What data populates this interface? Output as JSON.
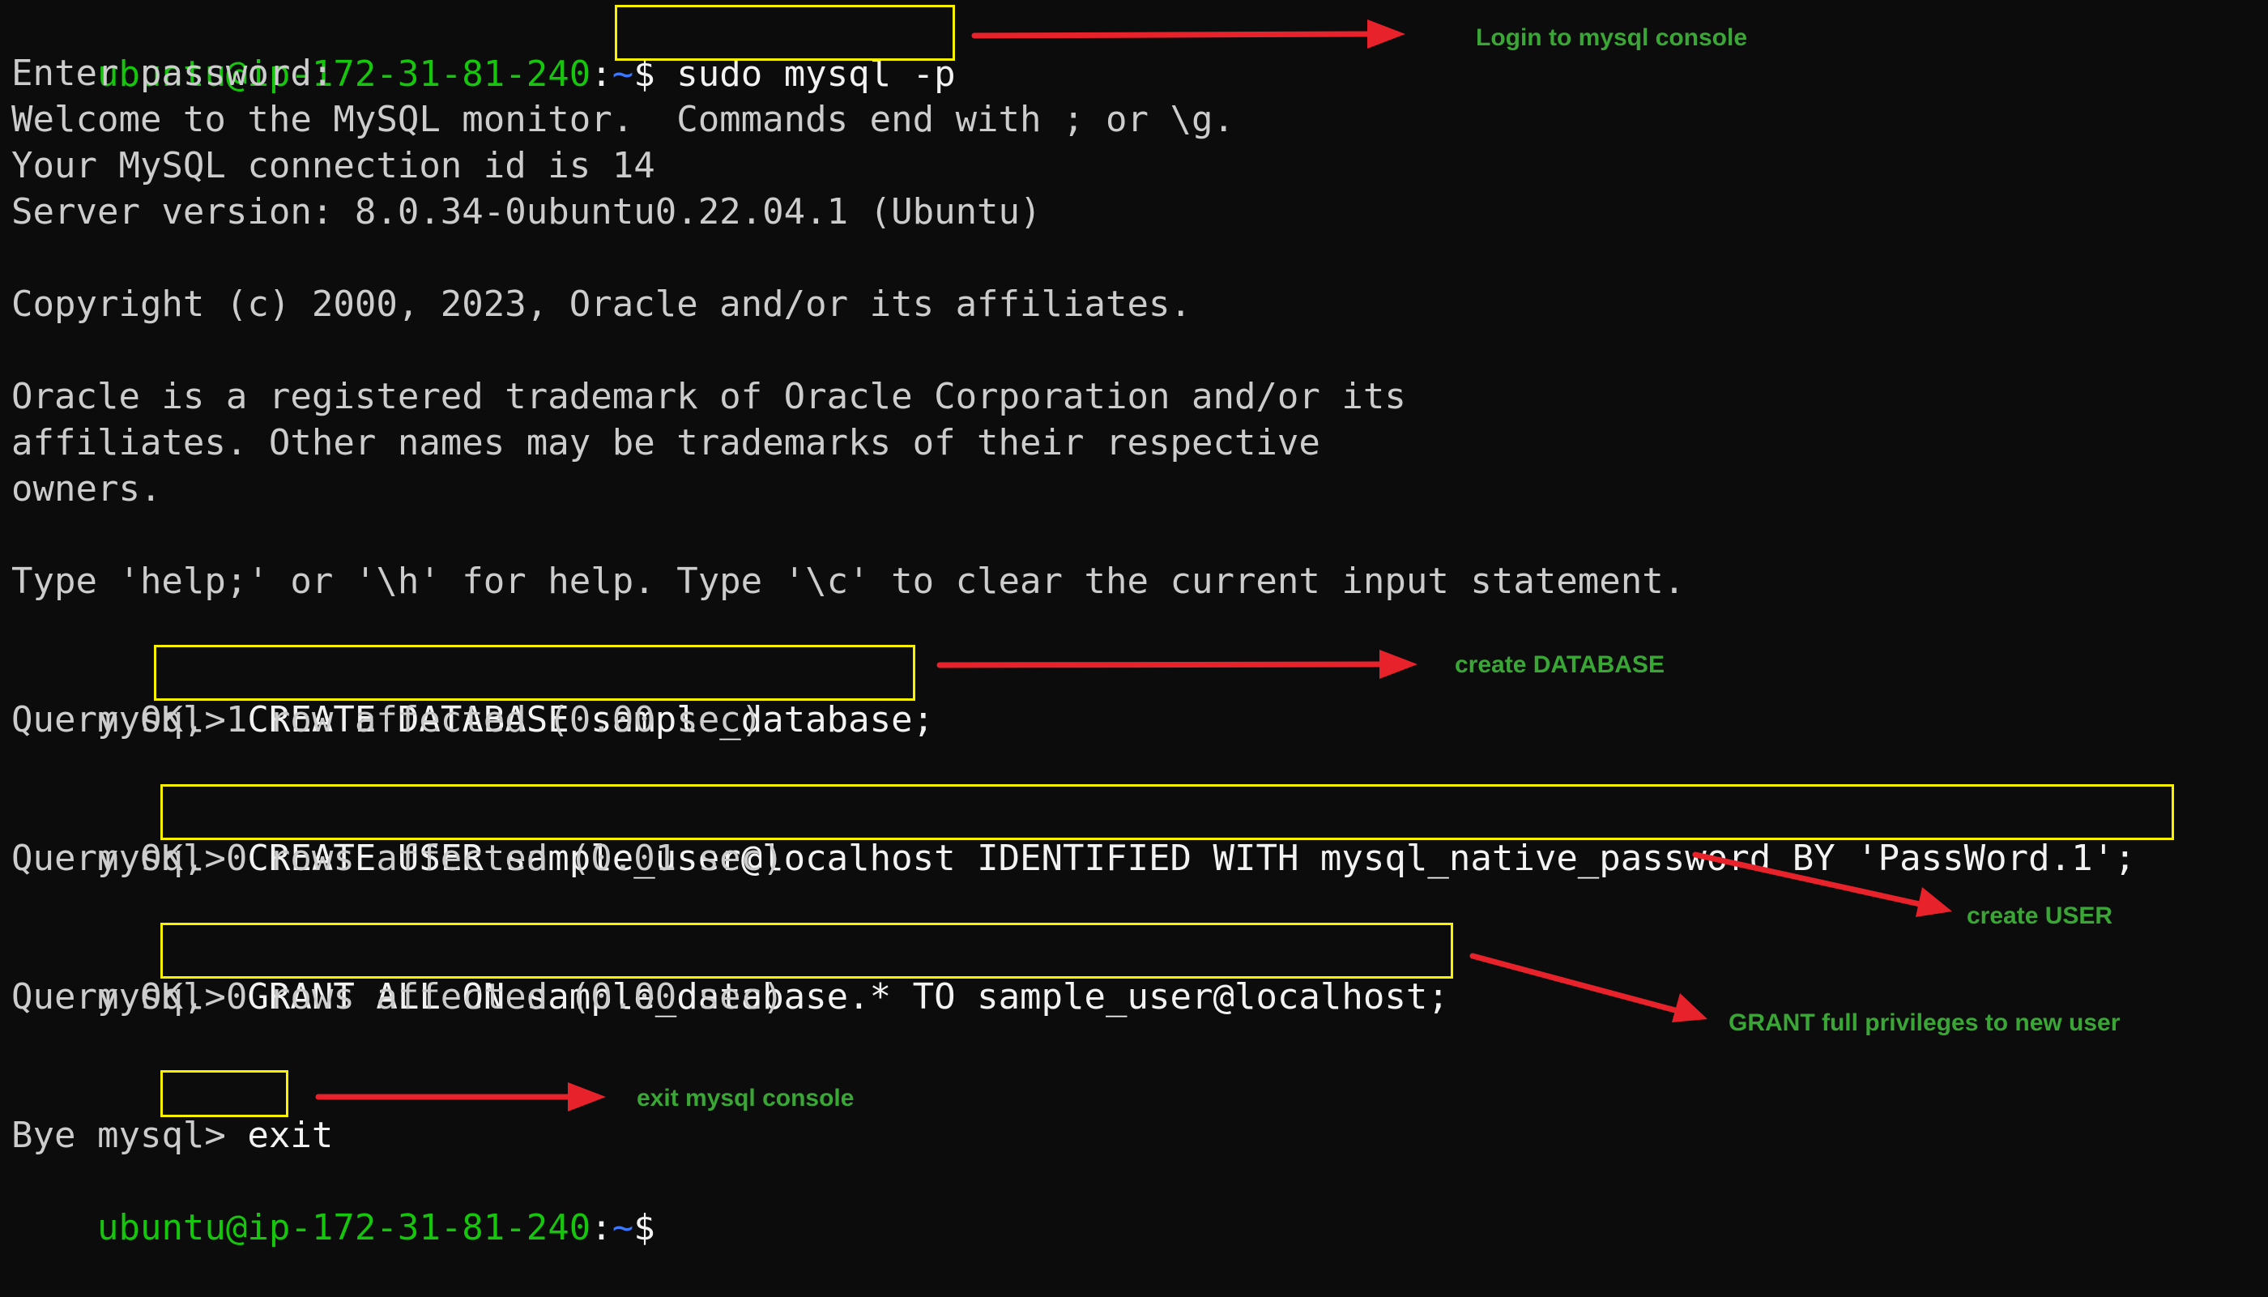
{
  "prompt": {
    "user_host": "ubuntu@ip-172-31-81-240",
    "sep": ":",
    "path": "~",
    "dollar": "$"
  },
  "lines": {
    "cmd_login": " sudo mysql -p",
    "enter_password": "Enter password:",
    "welcome": "Welcome to the MySQL monitor.  Commands end with ; or \\g.",
    "connection_id": "Your MySQL connection id is 14",
    "server_version": "Server version: 8.0.34-0ubuntu0.22.04.1 (Ubuntu)",
    "copyright": "Copyright (c) 2000, 2023, Oracle and/or its affiliates.",
    "trademark_1": "Oracle is a registered trademark of Oracle Corporation and/or its",
    "trademark_2": "affiliates. Other names may be trademarks of their respective",
    "trademark_3": "owners.",
    "help": "Type 'help;' or '\\h' for help. Type '\\c' to clear the current input statement.",
    "mysql_prompt": "mysql>",
    "cmd_create_db": " CREATE DATABASE sample_database;",
    "result_create_db": "Query OK, 1 row affected (0.00 sec)",
    "cmd_create_user": " CREATE USER sample_user@localhost IDENTIFIED WITH mysql_native_password BY 'PassWord.1';",
    "result_create_user": "Query OK, 0 rows affected (0.01 sec)",
    "cmd_grant": " GRANT ALL ON sample_database.* TO sample_user@localhost;",
    "result_grant": "Query OK, 0 rows affected (0.00 sec)",
    "cmd_exit": " exit",
    "bye": "Bye"
  },
  "annotations": {
    "login": "Login to mysql console",
    "create_db": "create DATABASE",
    "create_user": "create USER",
    "grant": "GRANT full privileges to new user",
    "exit": "exit mysql console"
  },
  "colors": {
    "background": "#0c0c0c",
    "text": "#cccccc",
    "prompt_green": "#16c60c",
    "prompt_blue": "#3b78ff",
    "highlight_box": "#f9f100",
    "arrow": "#e8222a",
    "annotation": "#3aa636"
  }
}
